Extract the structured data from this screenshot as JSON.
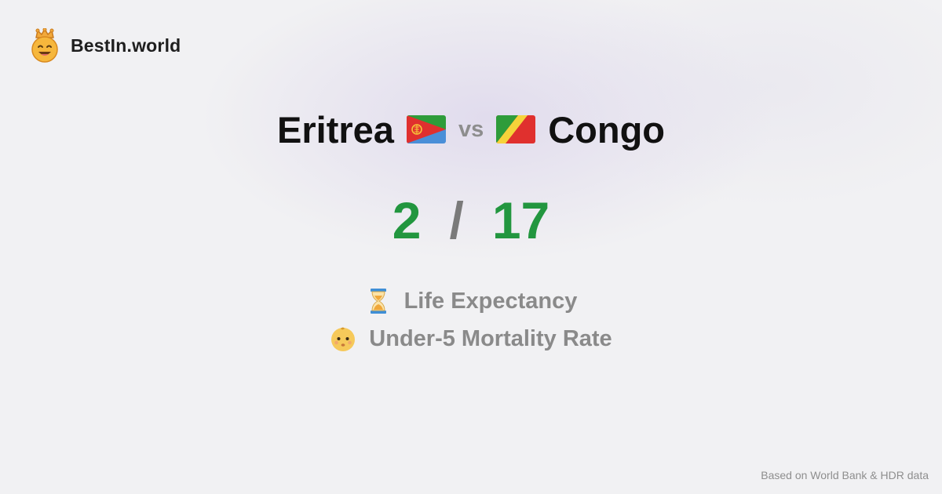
{
  "brand": {
    "logo_icon": "crown-smiley-icon",
    "name": "BestIn.world"
  },
  "comparison": {
    "left": {
      "country": "Eritrea",
      "flag_icon": "eritrea-flag-icon"
    },
    "vs_label": "vs",
    "right": {
      "country": "Congo",
      "flag_icon": "congo-flag-icon"
    }
  },
  "score": {
    "left": "2",
    "separator": "/",
    "right": "17",
    "color": "#22963f"
  },
  "metrics": [
    {
      "icon": "hourglass-icon",
      "label": "Life Expectancy"
    },
    {
      "icon": "baby-face-icon",
      "label": "Under-5 Mortality Rate"
    }
  ],
  "footer": {
    "source": "Based on World Bank & HDR data"
  }
}
